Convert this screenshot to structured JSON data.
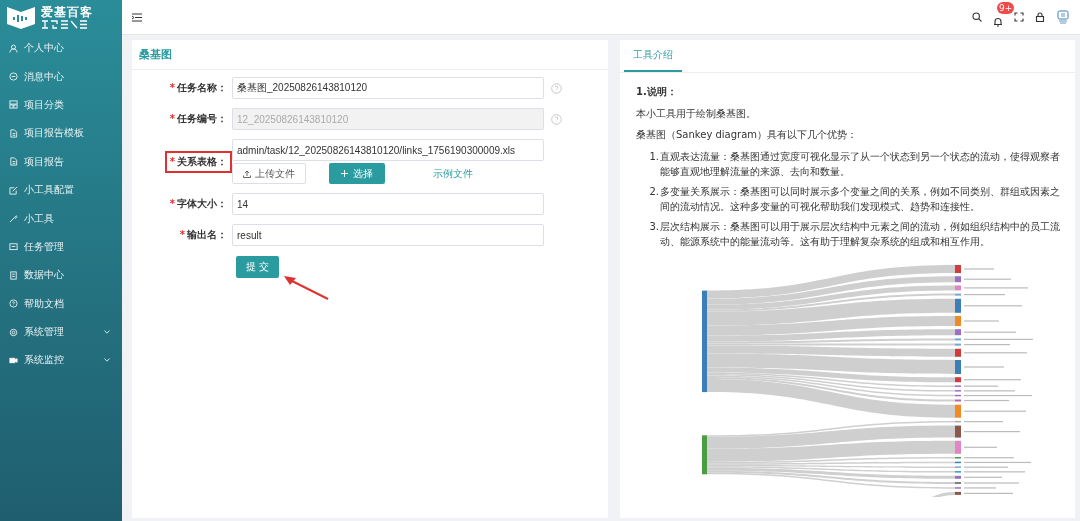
{
  "logo": {
    "text": "爱基百客"
  },
  "sidebar": {
    "items": [
      {
        "label": "个人中心",
        "expandable": false
      },
      {
        "label": "消息中心",
        "expandable": false
      },
      {
        "label": "项目分类",
        "expandable": false
      },
      {
        "label": "项目报告模板",
        "expandable": false
      },
      {
        "label": "项目报告",
        "expandable": false
      },
      {
        "label": "小工具配置",
        "expandable": false
      },
      {
        "label": "小工具",
        "expandable": false
      },
      {
        "label": "任务管理",
        "expandable": false
      },
      {
        "label": "数据中心",
        "expandable": false
      },
      {
        "label": "帮助文档",
        "expandable": false
      },
      {
        "label": "系统管理",
        "expandable": true
      },
      {
        "label": "系统监控",
        "expandable": true
      }
    ]
  },
  "topbar": {
    "notification_badge": "9+"
  },
  "form_panel": {
    "title": "桑基图",
    "fields": [
      {
        "label": "任务名称：",
        "value": "桑基图_20250826143810120",
        "required_mark": "*",
        "disabled": false,
        "help": true,
        "highlighted": false
      },
      {
        "label": "任务编号：",
        "value": "12_20250826143810120",
        "required_mark": "*",
        "disabled": true,
        "help": true,
        "highlighted": false
      },
      {
        "label": "关系表格：",
        "value": "admin/task/12_20250826143810120/links_1756190300009.xls",
        "required_mark": "*",
        "disabled": false,
        "help": false,
        "highlighted": true,
        "actions": {
          "upload": "上传文件",
          "select": "选择",
          "example": "示例文件"
        }
      },
      {
        "label": "字体大小：",
        "value": "14",
        "required_mark": "*",
        "disabled": false,
        "help": false,
        "highlighted": false
      },
      {
        "label": "输出名：",
        "value": "result",
        "required_mark": "*",
        "disabled": false,
        "help": false,
        "highlighted": false
      }
    ],
    "submit": "提 交",
    "annotation": {
      "kind": "arrow"
    }
  },
  "info_panel": {
    "tabs": [
      {
        "label": "工具介绍",
        "selected": true
      }
    ],
    "heading": "1.说明：",
    "paragraphs": [
      "本小工具用于绘制桑基图。",
      "桑基图（Sankey diagram）具有以下几个优势："
    ],
    "list": [
      {
        "number": "1.",
        "text": "直观表达流量：桑基图通过宽度可视化显示了从一个状态到另一个状态的流动，使得观察者能够直观地理解流量的来源、去向和数量。"
      },
      {
        "number": "2.",
        "text": "多变量关系展示：桑基图可以同时展示多个变量之间的关系，例如不同类别、群组或因素之间的流动情况。这种多变量的可视化帮助我们发现模式、趋势和连接性。"
      },
      {
        "number": "3.",
        "text": "层次结构展示：桑基图可以用于展示层次结构中元素之间的流动，例如组织结构中的员工流动、能源系统中的能量流动等。这有助于理解复杂系统的组成和相互作用。"
      }
    ],
    "figure": {
      "kind": "picture"
    }
  }
}
